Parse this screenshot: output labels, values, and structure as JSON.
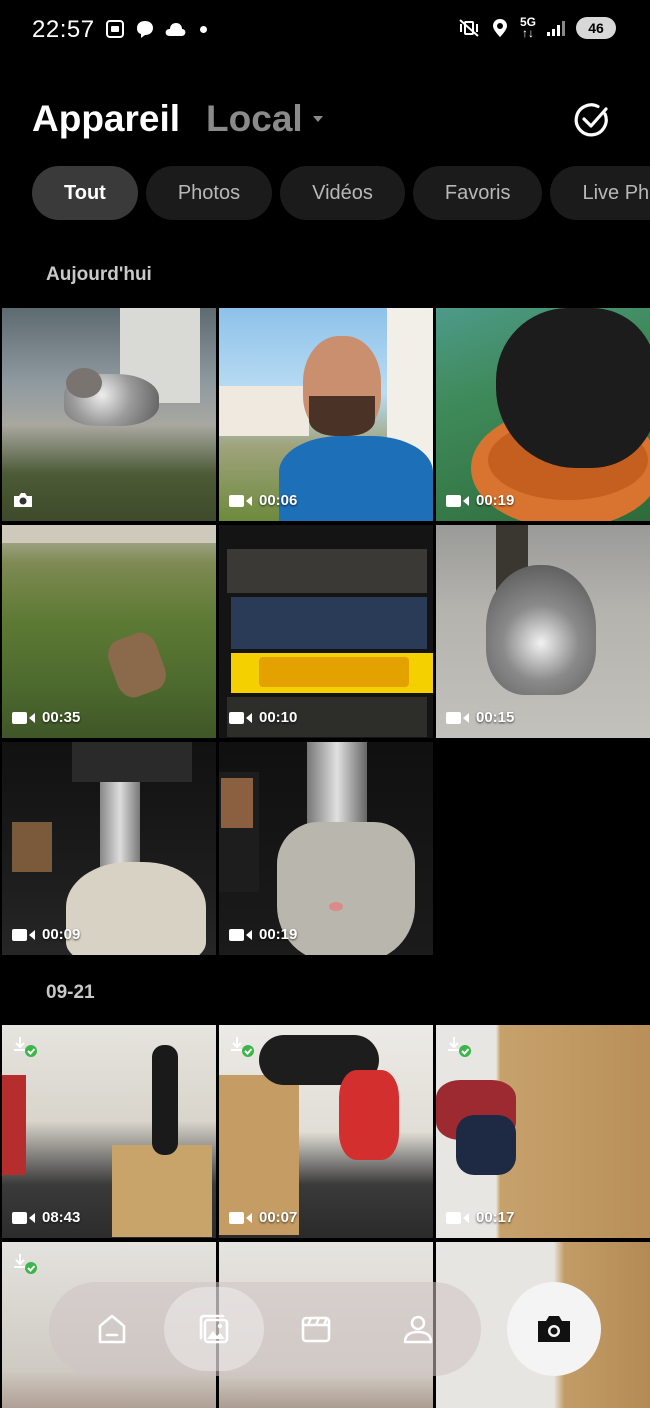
{
  "status_bar": {
    "time": "22:57",
    "network": "5G",
    "battery": "46",
    "icons": [
      "screenshot-icon",
      "chat-icon",
      "cloud-icon",
      "dot-icon",
      "mute-vibrate-icon",
      "location-icon",
      "signal-icon"
    ]
  },
  "header": {
    "title": "Appareil",
    "source": "Local",
    "select_icon": "check-circle-icon"
  },
  "filters": {
    "chips": [
      {
        "label": "Tout",
        "active": true
      },
      {
        "label": "Photos",
        "active": false
      },
      {
        "label": "Vidéos",
        "active": false
      },
      {
        "label": "Favoris",
        "active": false
      },
      {
        "label": "Live Photos",
        "active": false
      }
    ]
  },
  "sections": [
    {
      "label": "Aujourd'hui",
      "items": [
        {
          "kind": "photo",
          "subject": "cat on step"
        },
        {
          "kind": "video",
          "duration": "00:06",
          "subject": "selfie"
        },
        {
          "kind": "video",
          "duration": "00:19",
          "subject": "cat drinking"
        },
        {
          "kind": "video",
          "duration": "00:35",
          "subject": "garden"
        },
        {
          "kind": "video",
          "duration": "00:10",
          "subject": "board games"
        },
        {
          "kind": "video",
          "duration": "00:15",
          "subject": "cat sitting"
        },
        {
          "kind": "video",
          "duration": "00:09",
          "subject": "coffee machine"
        },
        {
          "kind": "video",
          "duration": "00:19",
          "subject": "cat mug"
        }
      ]
    },
    {
      "label": "09-21",
      "items": [
        {
          "kind": "video",
          "duration": "08:43",
          "synced": true,
          "subject": "gym"
        },
        {
          "kind": "video",
          "duration": "00:07",
          "synced": true,
          "subject": "gym exercise"
        },
        {
          "kind": "video",
          "duration": "00:17",
          "synced": true,
          "subject": "stretching"
        },
        {
          "kind": "video",
          "synced": true,
          "subject": "gym"
        },
        {
          "kind": "video",
          "subject": "gym"
        },
        {
          "kind": "video",
          "subject": "gym"
        }
      ]
    }
  ],
  "bottom_nav": {
    "items": [
      {
        "icon": "home-icon",
        "active": false
      },
      {
        "icon": "gallery-icon",
        "active": true
      },
      {
        "icon": "albums-icon",
        "active": false
      },
      {
        "icon": "profile-icon",
        "active": false
      }
    ],
    "camera_icon": "camera-icon"
  }
}
